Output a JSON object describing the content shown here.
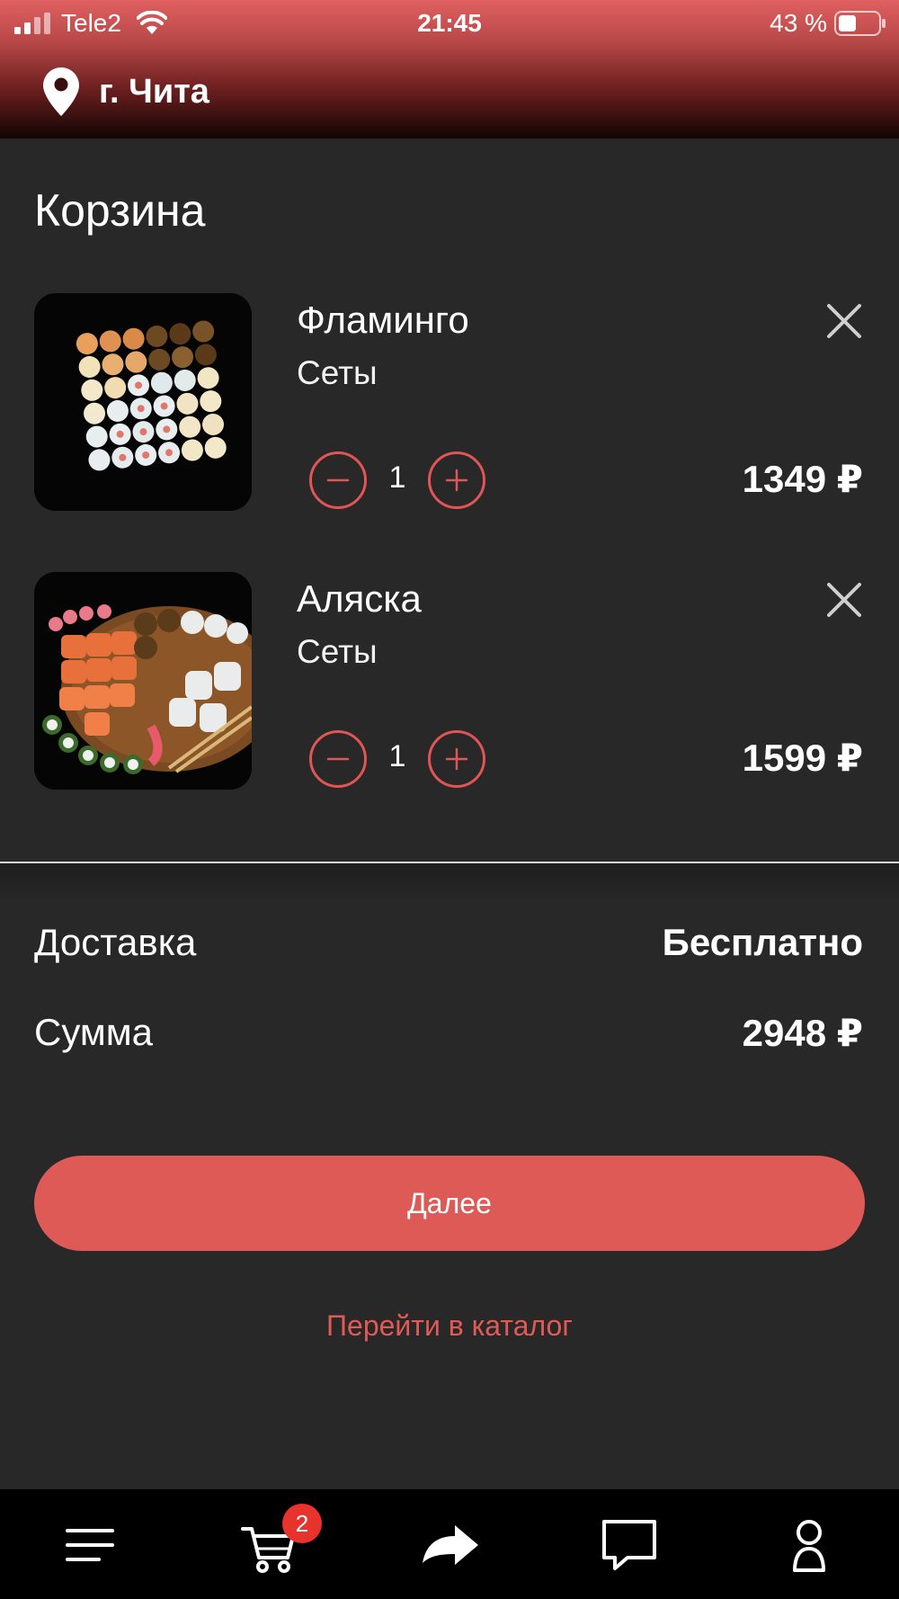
{
  "status_bar": {
    "carrier": "Tele2",
    "time": "21:45",
    "battery": "43 %"
  },
  "header": {
    "city": "г. Чита",
    "icon": "location-pin-icon"
  },
  "cart": {
    "title": "Корзина",
    "items": [
      {
        "name": "Фламинго",
        "category": "Сеты",
        "quantity": "1",
        "price": "1349 ₽"
      },
      {
        "name": "Аляска",
        "category": "Сеты",
        "quantity": "1",
        "price": "1599 ₽"
      }
    ]
  },
  "summary": {
    "delivery_label": "Доставка",
    "delivery_value": "Бесплатно",
    "sum_label": "Сумма",
    "sum_value": "2948 ₽"
  },
  "actions": {
    "next_label": "Далее",
    "catalog_label": "Перейти в каталог"
  },
  "bottom_nav": {
    "items": [
      "menu-icon",
      "cart-icon",
      "share-icon",
      "chat-icon",
      "profile-icon"
    ],
    "cart_badge": "2"
  },
  "colors": {
    "accent": "#de5a56",
    "background": "#282828",
    "badge": "#e8322c"
  }
}
